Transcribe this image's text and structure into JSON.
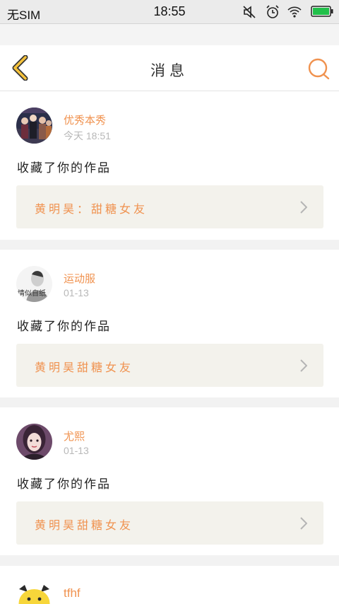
{
  "status_bar": {
    "carrier": "无SIM",
    "time": "18:55",
    "icons": [
      "mute-icon",
      "alarm-icon",
      "wifi-icon",
      "battery-icon"
    ]
  },
  "nav": {
    "title": "消息",
    "back_icon": "back-chevron-icon",
    "search_icon": "search-icon"
  },
  "colors": {
    "accent": "#f0924f",
    "back": "#f5c23c",
    "work_bg": "#f3f2ec",
    "battery": "#21c04a"
  },
  "messages": [
    {
      "user": "优秀本秀",
      "time": "今天 18:51",
      "action": "收藏了你的作品",
      "work": "黄明昊：甜糖女友"
    },
    {
      "user": "运动服",
      "time": "01-13",
      "action": "收藏了你的作品",
      "work": "黄明昊甜糖女友",
      "avatar_caption": "情似自纸"
    },
    {
      "user": "尤熙",
      "time": "01-13",
      "action": "收藏了你的作品",
      "work": "黄明昊甜糖女友"
    },
    {
      "user": "tfhf"
    }
  ]
}
